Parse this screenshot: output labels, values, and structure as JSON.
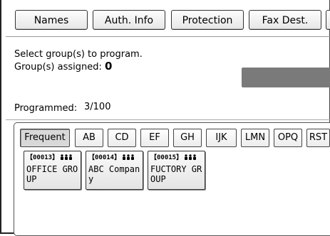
{
  "tabs": [
    {
      "label": "Names"
    },
    {
      "label": "Auth. Info"
    },
    {
      "label": "Protection"
    },
    {
      "label": "Fax Dest."
    }
  ],
  "instruction": "Select group(s) to program.",
  "assigned_label": "Group(s) assigned:",
  "assigned_value": "0",
  "programmed_label": "Programmed:",
  "programmed_value": "3/100",
  "group_tabs": [
    {
      "label": "Frequent",
      "selected": true
    },
    {
      "label": "AB"
    },
    {
      "label": "CD"
    },
    {
      "label": "EF"
    },
    {
      "label": "GH"
    },
    {
      "label": "IJK"
    },
    {
      "label": "LMN"
    },
    {
      "label": "OPQ"
    },
    {
      "label": "RST"
    }
  ],
  "entries": [
    {
      "number": "【00013】",
      "name": "OFFICE GROUP",
      "icon": "group-icon"
    },
    {
      "number": "【00014】",
      "name": "ABC Company",
      "icon": "group-icon"
    },
    {
      "number": "【00015】",
      "name": "FUCTORY GROUP",
      "icon": "group-icon"
    }
  ]
}
